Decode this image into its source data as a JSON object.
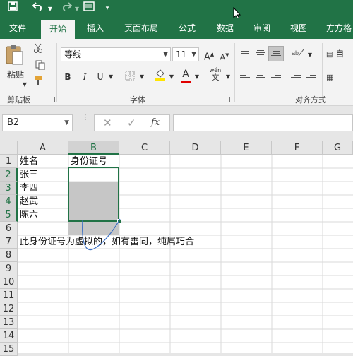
{
  "accent": "#217346",
  "qat": {
    "save_icon": "save-icon",
    "undo_icon": "undo-icon",
    "redo_icon": "redo-icon",
    "print_icon": "print-preview-icon",
    "customize_icon": "customize-icon"
  },
  "tabs": [
    {
      "label": "文件",
      "active": false
    },
    {
      "label": "开始",
      "active": true
    },
    {
      "label": "插入",
      "active": false
    },
    {
      "label": "页面布局",
      "active": false
    },
    {
      "label": "公式",
      "active": false
    },
    {
      "label": "数据",
      "active": false
    },
    {
      "label": "审阅",
      "active": false
    },
    {
      "label": "视图",
      "active": false
    },
    {
      "label": "方方格",
      "active": false
    }
  ],
  "ribbon": {
    "clipboard": {
      "paste_label": "粘贴",
      "group_label": "剪贴板"
    },
    "font": {
      "font_name": "等线",
      "font_size": "11",
      "group_label": "字体",
      "bold": "B",
      "italic": "I",
      "underline": "U",
      "grow": "A",
      "shrink": "A",
      "font_color_letter": "A",
      "wen": "wén",
      "wen_char": "文"
    },
    "alignment": {
      "group_label": "对齐方式",
      "auto_label": "自"
    }
  },
  "formula_bar": {
    "name_box": "B2",
    "formula": "",
    "fx": "fx"
  },
  "columns": [
    "A",
    "B",
    "C",
    "D",
    "E",
    "F",
    "G"
  ],
  "selected_column": "B",
  "rows": [
    "1",
    "2",
    "3",
    "4",
    "5",
    "6",
    "7",
    "8",
    "9",
    "10",
    "11",
    "12",
    "13",
    "14",
    "15"
  ],
  "selected_rows": [
    "2",
    "3",
    "4",
    "5"
  ],
  "cells": {
    "A1": "姓名",
    "B1": "身份证号",
    "A2": "张三",
    "A3": "李四",
    "A4": "赵武",
    "A5": "陈六",
    "A7": "此身份证号为虚拟的，如有雷同，纯属巧合"
  }
}
